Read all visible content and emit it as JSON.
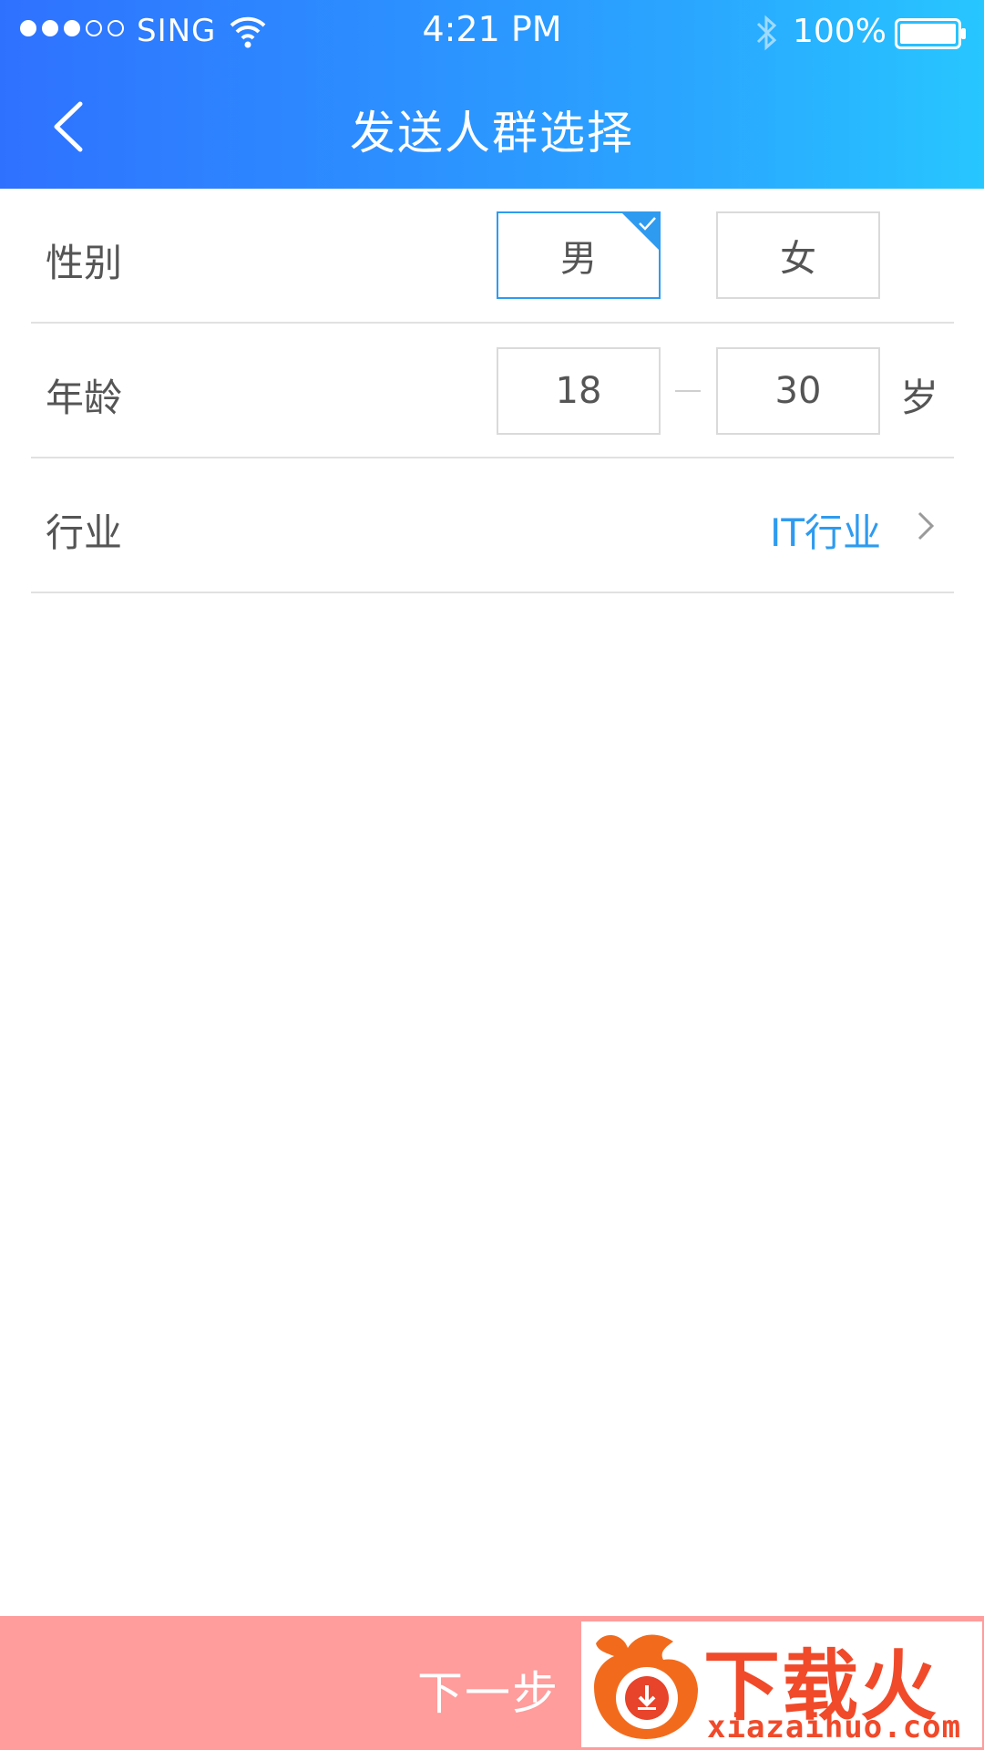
{
  "status_bar": {
    "carrier": "SING",
    "time": "4:21 PM",
    "battery": "100%"
  },
  "nav": {
    "title": "发送人群选择"
  },
  "gender": {
    "label": "性别",
    "options": [
      "男",
      "女"
    ],
    "selected": "男"
  },
  "age": {
    "label": "年龄",
    "min": "18",
    "max": "30",
    "unit": "岁"
  },
  "industry": {
    "label": "行业",
    "value": "IT行业"
  },
  "next_button": {
    "label": "下一步"
  },
  "watermark": {
    "title": "下载火",
    "url": "xiazaihuo.com"
  },
  "colors": {
    "accent": "#2e9bf0",
    "header_start": "#2f71ff",
    "header_end": "#27c6ff",
    "next_button": "#ff9c9c"
  },
  "icons": [
    "back-icon",
    "wifi-icon",
    "bluetooth-icon",
    "battery-icon",
    "check-icon",
    "chevron-right-icon"
  ]
}
